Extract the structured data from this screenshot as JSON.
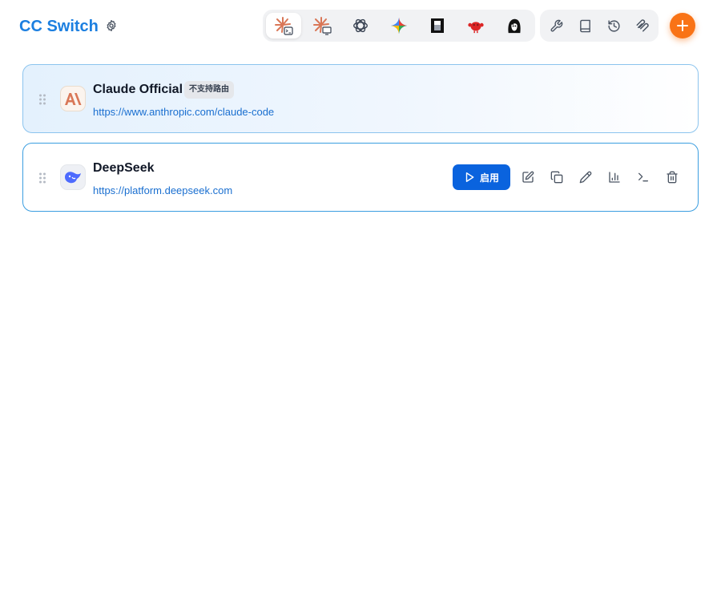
{
  "header": {
    "title": "CC Switch",
    "settings_icon": "gear-icon",
    "add_icon": "plus-icon",
    "accent_color": "#1c7fe0",
    "add_button_color": "#f97316"
  },
  "app_switcher": {
    "active_index": 0,
    "apps": [
      {
        "icon": "claude-code-icon"
      },
      {
        "icon": "claude-desktop-icon"
      },
      {
        "icon": "openai-codex-icon"
      },
      {
        "icon": "gemini-icon"
      },
      {
        "icon": "opencode-icon"
      },
      {
        "icon": "red-creature-icon"
      },
      {
        "icon": "avatar-agent-icon"
      }
    ]
  },
  "toolbar": {
    "items": [
      {
        "icon": "wrench-icon"
      },
      {
        "icon": "book-icon"
      },
      {
        "icon": "history-icon"
      },
      {
        "icon": "mcp-icon"
      }
    ]
  },
  "providers": [
    {
      "name": "Claude Official",
      "badge": "不支持路由",
      "url": "https://www.anthropic.com/claude-code",
      "icon": "anthropic-logo-icon",
      "current": true
    },
    {
      "name": "DeepSeek",
      "badge": "",
      "url": "https://platform.deepseek.com",
      "icon": "deepseek-whale-icon",
      "current": false,
      "actions": {
        "enable_label": "启用",
        "icons": [
          "edit-icon",
          "copy-icon",
          "pen-icon",
          "bar-chart-icon",
          "terminal-icon",
          "trash-icon"
        ]
      }
    }
  ]
}
